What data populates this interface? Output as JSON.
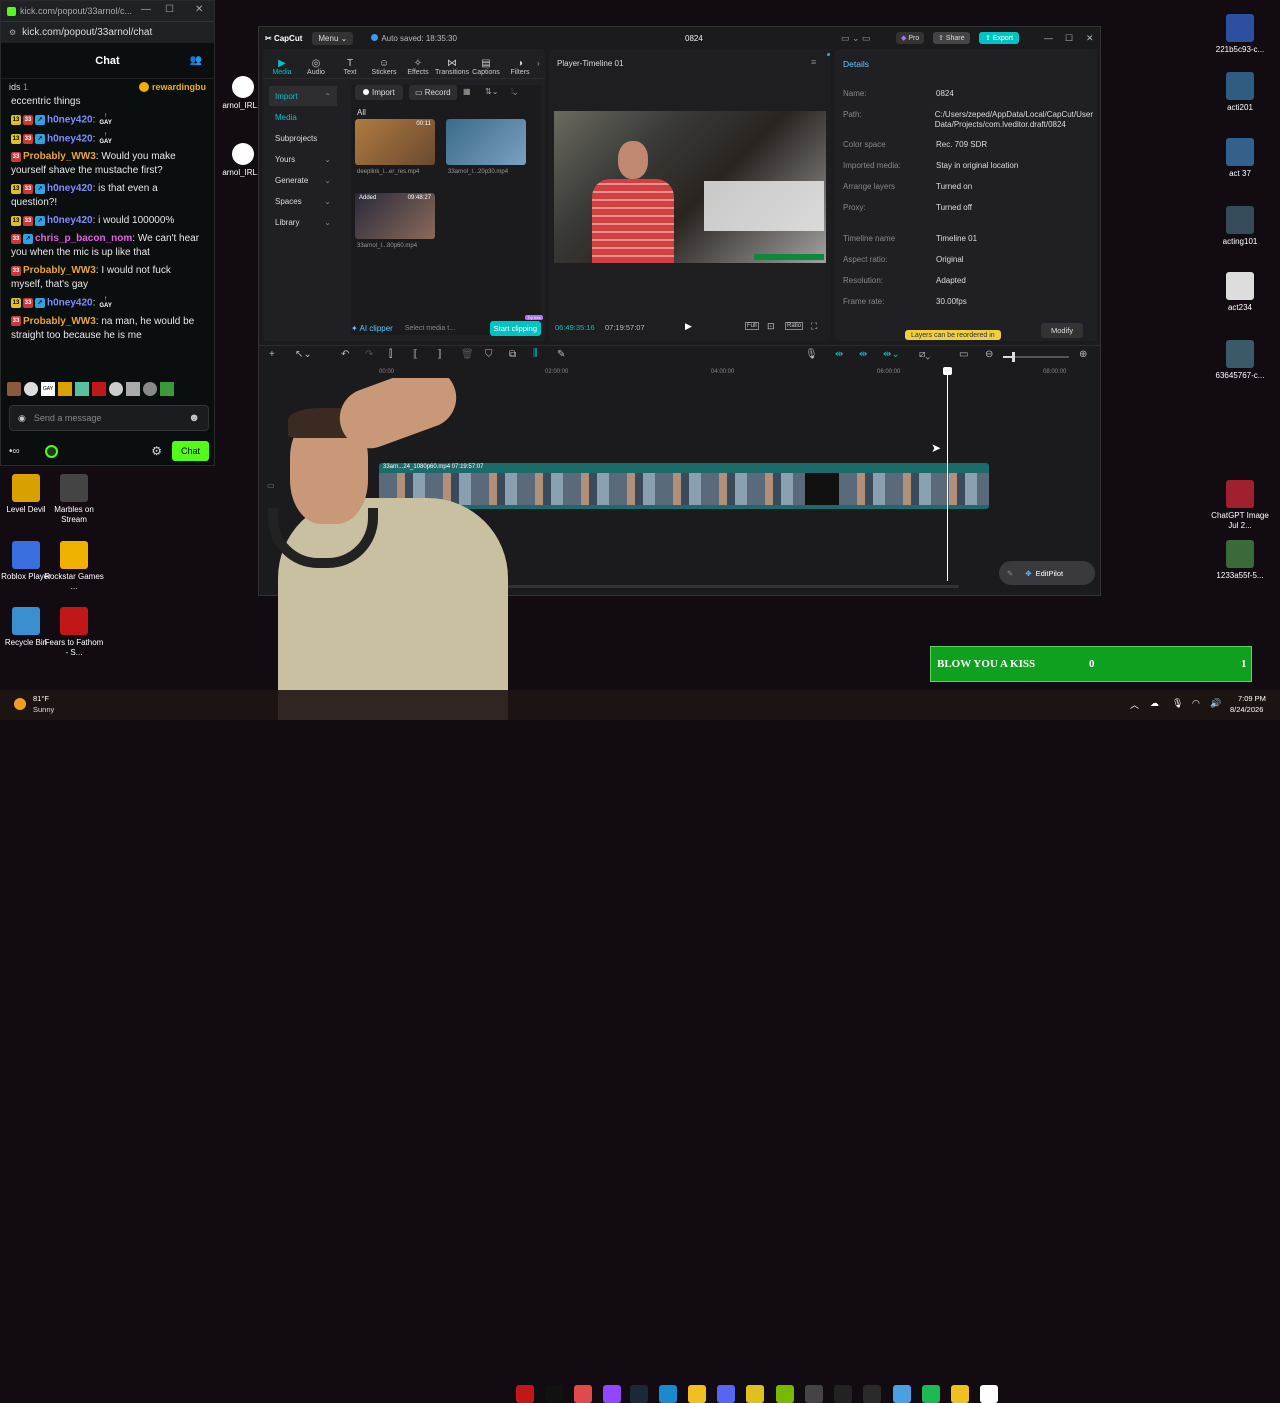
{
  "kick": {
    "tab_title": "kick.com/popout/33arnol/c...",
    "url": "kick.com/popout/33arnol/chat",
    "header": "Chat",
    "pinned_left": "ids",
    "pinned_count": "1",
    "pinned_right": "rewardingbu",
    "first_line": "eccentric things",
    "messages": [
      {
        "badges": [
          "13",
          "33",
          "k"
        ],
        "user": "h0ney420",
        "text": ":",
        "user_color": "#7f8cff",
        "emote": "GAY"
      },
      {
        "badges": [
          "13",
          "33",
          "k"
        ],
        "user": "h0ney420",
        "text": ":",
        "user_color": "#7f8cff",
        "emote": "GAY"
      },
      {
        "badges": [
          "33"
        ],
        "user": "Probably_WW3",
        "text": ": Would you make yourself shave the mustache first?",
        "user_color": "#e8a33a"
      },
      {
        "badges": [
          "13",
          "33",
          "k"
        ],
        "user": "h0ney420",
        "text": ": is that even a question?!",
        "user_color": "#7f8cff"
      },
      {
        "badges": [
          "13",
          "33",
          "k"
        ],
        "user": "h0ney420",
        "text": ": i would 100000%",
        "user_color": "#7f8cff"
      },
      {
        "badges": [
          "33",
          "k"
        ],
        "user": "chris_p_bacon_nom",
        "text": ": We can't hear you when the mic is up like that",
        "user_color": "#e060e0"
      },
      {
        "badges": [
          "33"
        ],
        "user": "Probably_WW3",
        "text": ": I would not fuck myself, that's gay",
        "user_color": "#e8a33a"
      },
      {
        "badges": [
          "13",
          "33",
          "k"
        ],
        "user": "h0ney420",
        "text": ":",
        "user_color": "#7f8cff",
        "emote": "GAY"
      },
      {
        "badges": [
          "33"
        ],
        "user": "Probably_WW3",
        "text": ": na man, he would be straight too because he is me",
        "user_color": "#e8a33a"
      }
    ],
    "input_placeholder": "Send a message",
    "chat_button": "Chat"
  },
  "capcut": {
    "logo": "CapCut",
    "menu": "Menu",
    "autosave": "Auto saved: 18:35:30",
    "project_title": "0824",
    "pro": "Pro",
    "share": "Share",
    "export": "Export",
    "tools": [
      "Media",
      "Audio",
      "Text",
      "Stickers",
      "Effects",
      "Transitions",
      "Captions",
      "Filters"
    ],
    "sidebar": [
      {
        "label": "Import",
        "active": true
      },
      {
        "label": "Media",
        "active": false,
        "selected": true
      },
      {
        "label": "Subprojects"
      },
      {
        "label": "Yours"
      },
      {
        "label": "Generate"
      },
      {
        "label": "Spaces"
      },
      {
        "label": "Library"
      }
    ],
    "import_btn": "Import",
    "record_btn": "Record",
    "all_label": "All",
    "media_items": [
      {
        "name": "deeplink_i...er_res.mp4",
        "duration": "00:11",
        "added": ""
      },
      {
        "name": "33arnol_I...20p30.mp4",
        "duration": "",
        "added": ""
      },
      {
        "name": "33arnol_I...80p60.mp4",
        "duration": "09:48:27",
        "added": "Added"
      }
    ],
    "ai_clipper": "AI clipper",
    "select_media": "Select media t...",
    "start_clipping": "Start clipping",
    "try_free": "Try free",
    "player_title": "Player-Timeline 01",
    "current_time": "06:49:35:16",
    "total_time": "07:19:57:07",
    "player_btns": [
      "Full",
      "Ratio"
    ],
    "details_title": "Details",
    "details": [
      {
        "k": "Name:",
        "v": "0824"
      },
      {
        "k": "Path:",
        "v": "C:/Users/zeped/AppData/Local/CapCut/User Data/Projects/com.lveditor.draft/0824"
      },
      {
        "k": "Color space",
        "v": "Rec. 709 SDR"
      },
      {
        "k": "Imported media:",
        "v": "Stay in original location"
      },
      {
        "k": "Arrange layers",
        "v": "Turned on"
      },
      {
        "k": "Proxy:",
        "v": "Turned off"
      },
      {
        "k": "Timeline name",
        "v": "Timeline 01"
      },
      {
        "k": "Aspect ratio:",
        "v": "Original"
      },
      {
        "k": "Resolution:",
        "v": "Adapted"
      },
      {
        "k": "Frame rate:",
        "v": "30.00fps"
      }
    ],
    "layers_tip": "Layers can be reordered in",
    "modify": "Modify",
    "ruler": [
      "00:00",
      "02:00:00",
      "04:00:00",
      "06:00:00",
      "08:00:00"
    ],
    "clip_label": "33arn...24_1080p60.mp4   07:19:57:07",
    "editpilot": "EditPilot"
  },
  "desktop": {
    "left_icons": [
      {
        "label": "Level Devil",
        "color": "#d8a000"
      },
      {
        "label": "Marbles on Stream",
        "color": "#444"
      },
      {
        "label": "Roblox Player",
        "color": "#3a6fe0"
      },
      {
        "label": "Rockstar Games ...",
        "color": "#f0b000"
      },
      {
        "label": "Recycle Bin",
        "color": "#3a8fd0"
      },
      {
        "label": "Fears to Fathom - S...",
        "color": "#c01818"
      }
    ],
    "partial_icons": [
      "arnol_IRL...",
      "arnol_IRL..."
    ],
    "right_icons": [
      {
        "label": "221b5c93-c...",
        "color": "#2c4fa0"
      },
      {
        "label": "acti201",
        "color": "#2f5c80"
      },
      {
        "label": "act 37",
        "color": "#35608a"
      },
      {
        "label": "acting101",
        "color": "#354b5a"
      },
      {
        "label": "act234",
        "color": "#ddd"
      },
      {
        "label": "63645767-c...",
        "color": "#3a5a6a"
      },
      {
        "label": "ChatGPT Image Jul 2...",
        "color": "#a02030"
      },
      {
        "label": "1233a55f-5...",
        "color": "#3a6a3a"
      }
    ]
  },
  "overlay": {
    "text": "BLOW YOU A KISS",
    "count": "0",
    "goal": "1"
  },
  "taskbar": {
    "temp": "81°F",
    "weather": "Sunny",
    "time": "7:09 PM",
    "date": "8/24/2026"
  },
  "colors": {
    "kick_green": "#53fc18",
    "capcut_teal": "#00c4c4",
    "clip_teal": "#1b6b6b",
    "overlay_green": "#0fa020"
  }
}
